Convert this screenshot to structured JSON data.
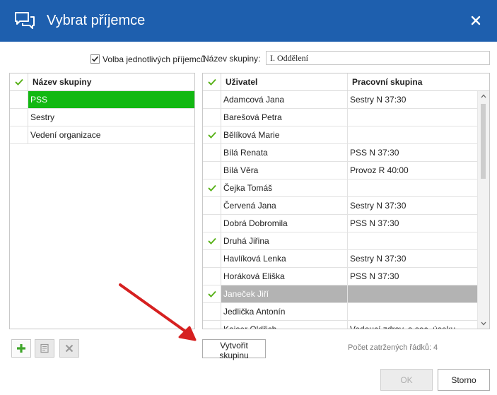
{
  "window": {
    "title": "Vybrat příjemce"
  },
  "options": {
    "individual_label": "Volba jednotlivých příjemců",
    "individual_checked": true,
    "group_name_label": "Název skupiny:",
    "group_name_value": "I. Oddělení"
  },
  "groups": {
    "header": "Název skupiny",
    "rows": [
      {
        "name": "PSS",
        "selected": true
      },
      {
        "name": "Sestry"
      },
      {
        "name": "Vedení organizace"
      }
    ]
  },
  "users": {
    "header_user": "Uživatel",
    "header_group": "Pracovní skupina",
    "rows": [
      {
        "user": "Adamcová Jana",
        "group": "Sestry N 37:30",
        "checked": false
      },
      {
        "user": "Barešová Petra",
        "group": "",
        "checked": false
      },
      {
        "user": "Bělíková Marie",
        "group": "",
        "checked": true
      },
      {
        "user": "Bílá Renata",
        "group": "PSS N 37:30",
        "checked": false
      },
      {
        "user": "Bílá Věra",
        "group": "Provoz R 40:00",
        "checked": false
      },
      {
        "user": "Čejka Tomáš",
        "group": "",
        "checked": true
      },
      {
        "user": "Červená Jana",
        "group": "Sestry N 37:30",
        "checked": false
      },
      {
        "user": "Dobrá Dobromila",
        "group": "PSS N 37:30",
        "checked": false
      },
      {
        "user": "Druhá Jiřina",
        "group": "",
        "checked": true
      },
      {
        "user": "Havlíková Lenka",
        "group": "Sestry N 37:30",
        "checked": false
      },
      {
        "user": "Horáková Eliška",
        "group": "PSS N 37:30",
        "checked": false
      },
      {
        "user": "Janeček Jiří",
        "group": "",
        "checked": true,
        "selected": true
      },
      {
        "user": "Jedlička Antonín",
        "group": "",
        "checked": false
      },
      {
        "user": "Kaiser Oldřich",
        "group": "Vedoucí zdrav. a soc. úseku",
        "checked": false
      }
    ]
  },
  "buttons": {
    "create_group": "Vytvořit skupinu",
    "ok": "OK",
    "cancel": "Storno"
  },
  "status": {
    "checked_rows": "Počet zatržených řádků: 4"
  },
  "colors": {
    "title_bar": "#1e5fae",
    "selection_green": "#12b812",
    "selection_gray": "#b3b3b3",
    "check_green": "#5cb31e",
    "arrow_red": "#d62020"
  },
  "icons": [
    "chat-bubbles-icon",
    "close-icon",
    "checkmark-icon",
    "plus-icon",
    "edit-note-icon",
    "delete-x-icon",
    "scroll-up-icon",
    "scroll-down-icon"
  ]
}
